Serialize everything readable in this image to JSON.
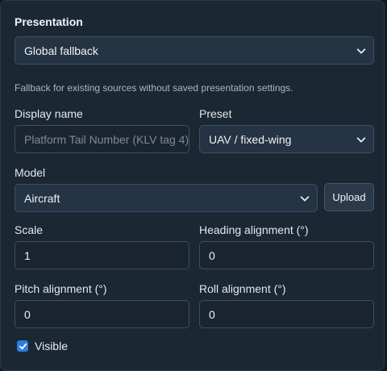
{
  "section": {
    "title": "Presentation"
  },
  "source_select": {
    "value": "Global fallback"
  },
  "help": {
    "text": "Fallback for existing sources without saved presentation settings."
  },
  "display_name": {
    "label": "Display name",
    "placeholder": "Platform Tail Number (KLV tag 4)",
    "value": ""
  },
  "preset": {
    "label": "Preset",
    "value": "UAV / fixed-wing"
  },
  "model": {
    "label": "Model",
    "value": "Aircraft",
    "upload_label": "Upload"
  },
  "scale": {
    "label": "Scale",
    "value": "1"
  },
  "heading": {
    "label": "Heading alignment (°)",
    "value": "0"
  },
  "pitch": {
    "label": "Pitch alignment (°)",
    "value": "0"
  },
  "roll": {
    "label": "Roll alignment (°)",
    "value": "0"
  },
  "visible": {
    "label": "Visible",
    "checked": true
  },
  "colors": {
    "accent": "#2f7de1",
    "panel": "#1b2733",
    "field": "#253444"
  }
}
